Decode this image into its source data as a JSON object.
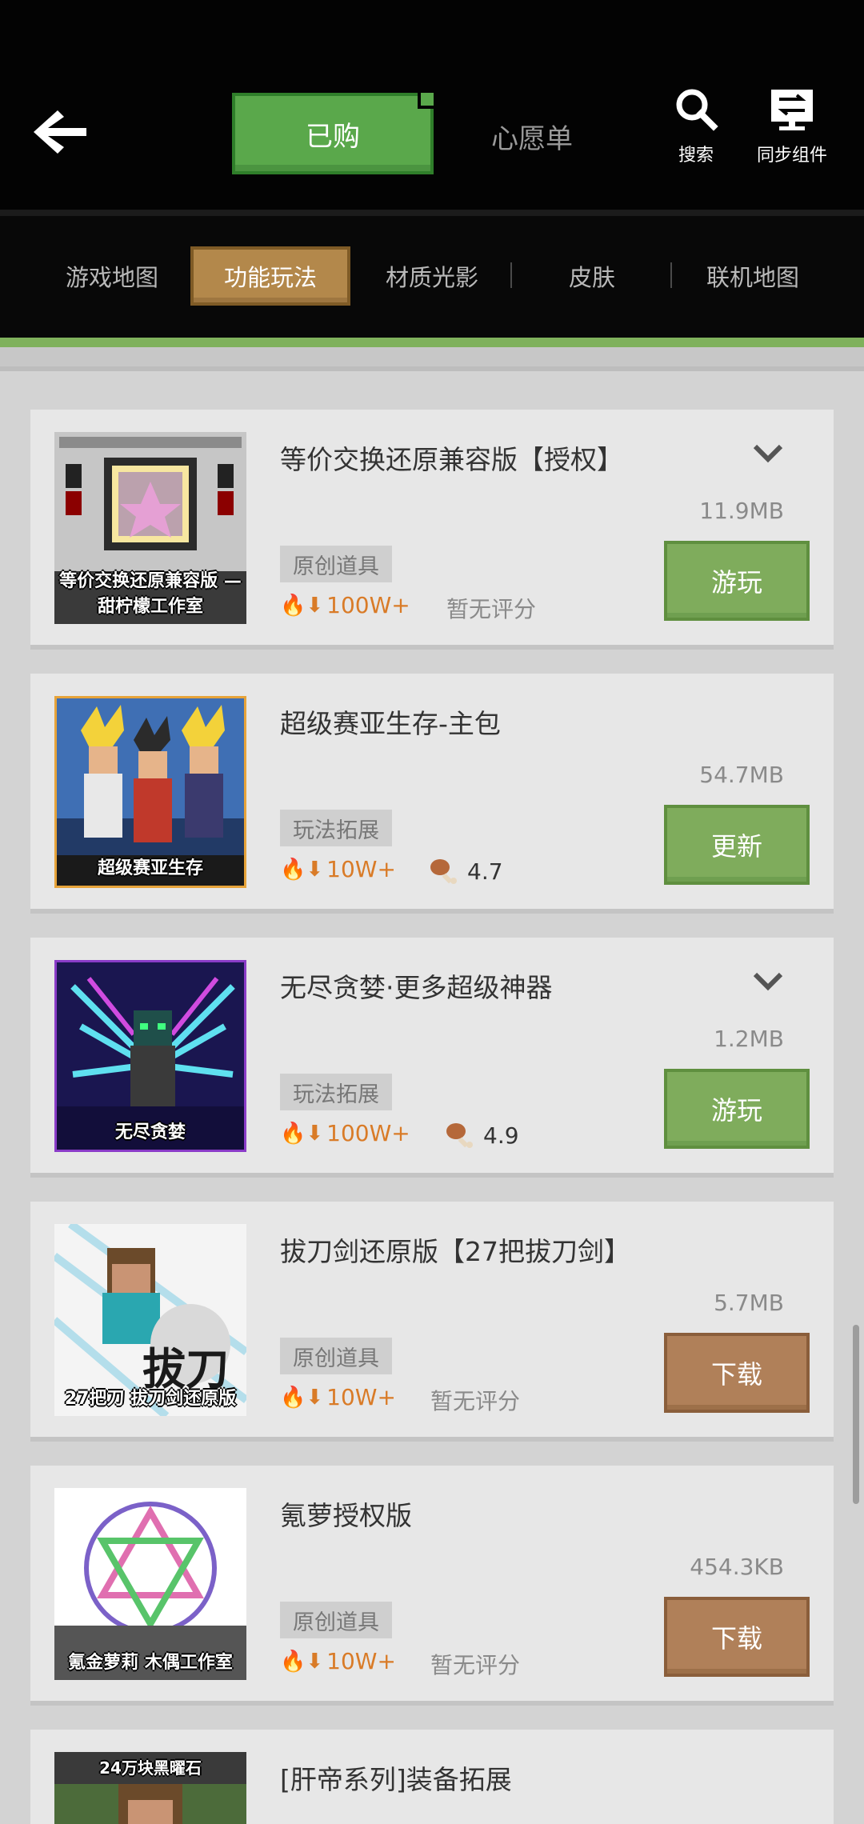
{
  "header": {
    "tabs": [
      {
        "label": "已购",
        "active": true
      },
      {
        "label": "心愿单",
        "active": false
      }
    ],
    "search_label": "搜索",
    "sync_label": "同步组件"
  },
  "categories": [
    {
      "label": "游戏地图",
      "active": false
    },
    {
      "label": "功能玩法",
      "active": true
    },
    {
      "label": "材质光影",
      "active": false
    },
    {
      "label": "皮肤",
      "active": false
    },
    {
      "label": "联机地图",
      "active": false
    }
  ],
  "items": [
    {
      "title": "等价交换还原兼容版【授权】",
      "size": "11.9MB",
      "tag": "原创道具",
      "downloads": "100W+",
      "rating": "暂无评分",
      "button": "游玩",
      "button_color": "#7fac5c",
      "has_expand": true,
      "thumb_text": "等价交换还原兼容版 —甜柠檬工作室"
    },
    {
      "title": "超级赛亚生存-主包",
      "size": "54.7MB",
      "tag": "玩法拓展",
      "downloads": "10W+",
      "rating": "4.7",
      "button": "更新",
      "button_color": "#7fac5c",
      "has_expand": false,
      "thumb_text": "超级赛亚生存"
    },
    {
      "title": "无尽贪婪·更多超级神器",
      "size": "1.2MB",
      "tag": "玩法拓展",
      "downloads": "100W+",
      "rating": "4.9",
      "button": "游玩",
      "button_color": "#7fac5c",
      "has_expand": true,
      "thumb_text": "无尽贪婪"
    },
    {
      "title": "拔刀剑还原版【27把拔刀剑】",
      "size": "5.7MB",
      "tag": "原创道具",
      "downloads": "10W+",
      "rating": "暂无评分",
      "button": "下载",
      "button_color": "#b08059",
      "has_expand": false,
      "thumb_text": "27把刀 拔刀剑还原版"
    },
    {
      "title": "氪萝授权版",
      "size": "454.3KB",
      "tag": "原创道具",
      "downloads": "10W+",
      "rating": "暂无评分",
      "button": "下载",
      "button_color": "#b08059",
      "has_expand": false,
      "thumb_text": "氪金萝莉 木偶工作室"
    },
    {
      "title": "[肝帝系列]装备拓展",
      "thumb_text": "24万块黑曜石"
    }
  ]
}
